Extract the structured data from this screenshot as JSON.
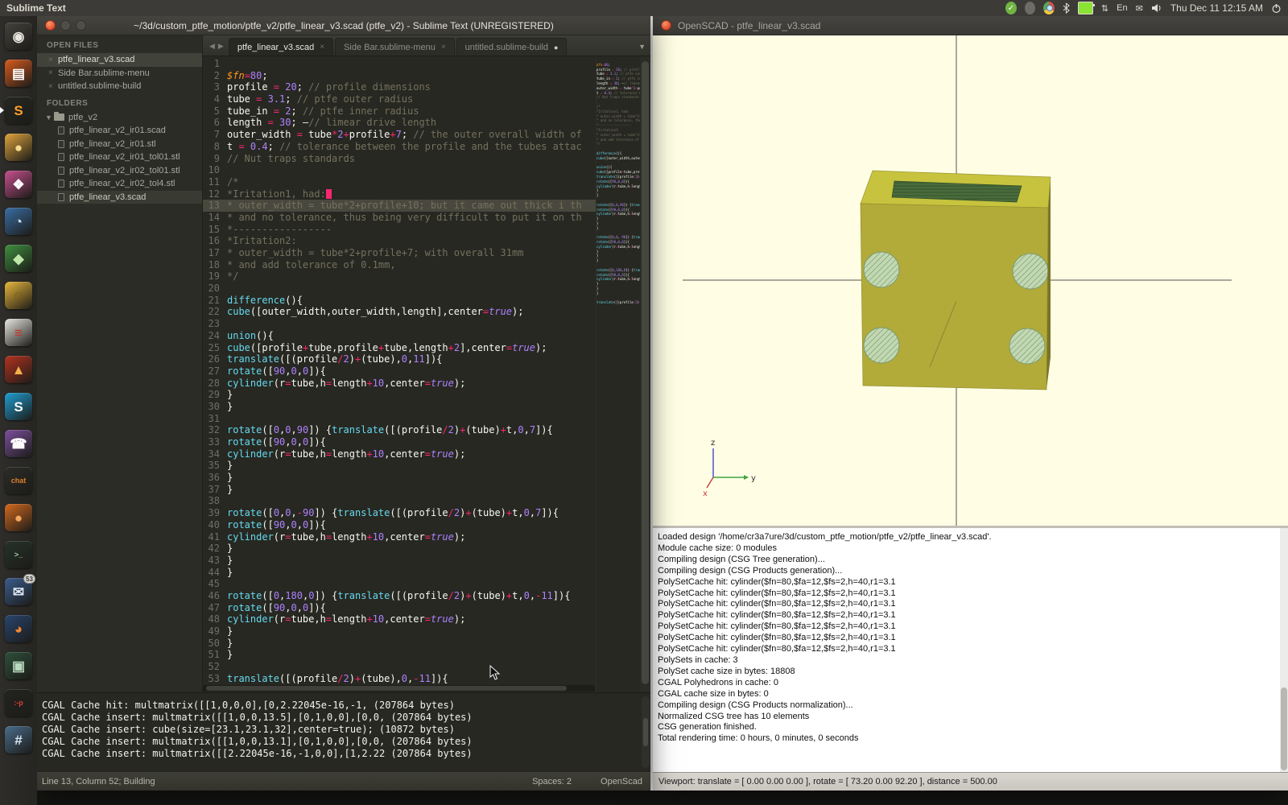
{
  "topbar": {
    "app_label": "Sublime Text",
    "keyboard_layout": "En",
    "clock": "Thu Dec 11 12:15 AM",
    "tray_icon_names": [
      "update-ok-icon",
      "indicator-icon",
      "chromium-tray-icon",
      "bluetooth-icon",
      "battery-icon",
      "network-arrows-icon",
      "keyboard-layout-indicator",
      "mail-indicator-icon",
      "volume-icon",
      "clock",
      "power-menu-icon"
    ]
  },
  "launcher": {
    "icons": [
      {
        "name": "dash-home",
        "glyph": "◉",
        "bg": "#45423c",
        "fg": "#e8e4de"
      },
      {
        "name": "files",
        "glyph": "▤",
        "bg": "#d95b1e",
        "fg": "#ffffff"
      },
      {
        "name": "sublime-text",
        "glyph": "S",
        "bg": "#262622",
        "fg": "#ff9d2e",
        "running": true
      },
      {
        "name": "blender-ball",
        "glyph": "●",
        "bg": "#e0a43c",
        "fg": "#f6d98a"
      },
      {
        "name": "photos",
        "glyph": "❖",
        "bg": "#c84f8e",
        "fg": "#ffffff"
      },
      {
        "name": "chromium-browser",
        "glyph": "◔",
        "bg": "#3a6ea5",
        "fg": "#cfe2f3"
      },
      {
        "name": "leaf-app",
        "glyph": "◆",
        "bg": "#3f8f3f",
        "fg": "#bfe6a8"
      },
      {
        "name": "cheese",
        "glyph": "☺",
        "bg": "#e8b63a",
        "fg": "#7a5a12"
      },
      {
        "name": "text-editor",
        "glyph": "≡",
        "bg": "#e9e6e0",
        "fg": "#c0392b"
      },
      {
        "name": "flame-app",
        "glyph": "▲",
        "bg": "#b5321e",
        "fg": "#f5b04a"
      },
      {
        "name": "skype",
        "glyph": "S",
        "bg": "#1e9fd4",
        "fg": "#ffffff"
      },
      {
        "name": "viber",
        "glyph": "☎",
        "bg": "#7d4f9e",
        "fg": "#ffffff"
      },
      {
        "name": "xchat",
        "glyph": "chat",
        "bg": "#2b2b28",
        "fg": "#e07f28",
        "small": true
      },
      {
        "name": "orange-ball-app",
        "glyph": "●",
        "bg": "#d4691e",
        "fg": "#f2a65e"
      },
      {
        "name": "terminal",
        "glyph": ">_",
        "bg": "#26322a",
        "fg": "#9fd49f",
        "small": true
      },
      {
        "name": "mail-client",
        "glyph": "✉",
        "bg": "#3b5d8f",
        "fg": "#dfe8f4",
        "badge": "53"
      },
      {
        "name": "firefox",
        "glyph": "◕",
        "bg": "#28456e",
        "fg": "#ef8533"
      },
      {
        "name": "camera-app",
        "glyph": "▣",
        "bg": "#2e4f3a",
        "fg": "#b9d9bf"
      },
      {
        "name": "tongue-app",
        "glyph": ":-p",
        "bg": "#232320",
        "fg": "#d8432f",
        "small": true
      },
      {
        "name": "keyboard-app",
        "glyph": "#",
        "bg": "#4a6d8c",
        "fg": "#dce8f2"
      }
    ]
  },
  "sublime": {
    "title": "~/3d/custom_ptfe_motion/ptfe_v2/ptfe_linear_v3.scad (ptfe_v2) - Sublime Text (UNREGISTERED)",
    "sidebar": {
      "open_files_header": "OPEN FILES",
      "open_files": [
        "ptfe_linear_v3.scad",
        "Side Bar.sublime-menu",
        "untitled.sublime-build"
      ],
      "open_files_selected": 0,
      "folders_header": "FOLDERS",
      "folder_name": "ptfe_v2",
      "folder_files": [
        "ptfe_linear_v2_ir01.scad",
        "ptfe_linear_v2_ir01.stl",
        "ptfe_linear_v2_ir01_tol01.stl",
        "ptfe_linear_v2_ir02_tol01.stl",
        "ptfe_linear_v2_ir02_tol4.stl",
        "ptfe_linear_v3.scad"
      ],
      "folder_files_selected": 5
    },
    "tabs": [
      {
        "label": "ptfe_linear_v3.scad",
        "state": "close",
        "active": true
      },
      {
        "label": "Side Bar.sublime-menu",
        "state": "close",
        "active": false
      },
      {
        "label": "untitled.sublime-build",
        "state": "dirty",
        "active": false
      }
    ],
    "editor": {
      "active_line": 13,
      "cursor_line": 12
    },
    "code_lines": [
      "",
      "$fn=80;",
      "profile = 20; // profile dimensions",
      "tube = 3.1; // ptfe outer radius",
      "tube_in = 2; // ptfe inner radius",
      "length = 30; —// limear drive length",
      "outer_width = tube*2+profile+7; // the outer overall width of",
      "t = 0.4; // tolerance between the profile and the tubes attac",
      "// Nut traps standards",
      "",
      "/*",
      "*Iritation1, had:",
      "* outer_width = tube*2+profile+10; but it came out thick i th",
      "* and no tolerance, thus being very difficult to put it on th",
      "*-----------------",
      "*Iritation2:",
      "* outer_width = tube*2+profile+7; with overall 31mm",
      "* and add tolerance of 0.1mm,",
      "*/",
      "",
      "difference(){",
      "cube([outer_width,outer_width,length],center=true);",
      "",
      "union(){",
      "cube([profile+tube,profile+tube,length+2],center=true);",
      "translate([(profile/2)+(tube),0,11]){",
      "rotate([90,0,0]){",
      "cylinder(r=tube,h=length+10,center=true);",
      "}",
      "}",
      "",
      "rotate([0,0,90]) {translate([(profile/2)+(tube)+t,0,7]){",
      "rotate([90,0,0]){",
      "cylinder(r=tube,h=length+10,center=true);",
      "}",
      "}",
      "}",
      "",
      "rotate([0,0,-90]) {translate([(profile/2)+(tube)+t,0,7]){",
      "rotate([90,0,0]){",
      "cylinder(r=tube,h=length+10,center=true);",
      "}",
      "}",
      "}",
      "",
      "rotate([0,180,0]) {translate([(profile/2)+(tube)+t,0,-11]){",
      "rotate([90,0,0]){",
      "cylinder(r=tube,h=length+10,center=true);",
      "}",
      "}",
      "}",
      "",
      "translate([(profile/2)+(tube),0,-11]){"
    ],
    "build_output": [
      "CGAL Cache hit: multmatrix([[1,0,0,0],[0,2.22045e-16,-1, (207864 bytes)",
      "CGAL Cache insert: multmatrix([[1,0,0,13.5],[0,1,0,0],[0,0, (207864 bytes)",
      "CGAL Cache insert: cube(size=[23.1,23.1,32],center=true); (10872 bytes)",
      "CGAL Cache insert: multmatrix([[1,0,0,13.1],[0,1,0,0],[0,0, (207864 bytes)",
      "CGAL Cache insert: multmatrix([[2.22045e-16,-1,0,0],[1,2.22 (207864 bytes)"
    ],
    "status": {
      "left": "Line 13, Column 52; Building",
      "spaces": "Spaces: 2",
      "syntax": "OpenScad"
    }
  },
  "openscad": {
    "title": "OpenSCAD - ptfe_linear_v3.scad",
    "axis": {
      "x": "x",
      "y": "y",
      "z": "z"
    },
    "console_lines": [
      "Loaded design '/home/cr3a7ure/3d/custom_ptfe_motion/ptfe_v2/ptfe_linear_v3.scad'.",
      "Module cache size: 0 modules",
      "Compiling design (CSG Tree generation)...",
      "Compiling design (CSG Products generation)...",
      "PolySetCache hit: cylinder($fn=80,$fa=12,$fs=2,h=40,r1=3.1",
      "PolySetCache hit: cylinder($fn=80,$fa=12,$fs=2,h=40,r1=3.1",
      "PolySetCache hit: cylinder($fn=80,$fa=12,$fs=2,h=40,r1=3.1",
      "PolySetCache hit: cylinder($fn=80,$fa=12,$fs=2,h=40,r1=3.1",
      "PolySetCache hit: cylinder($fn=80,$fa=12,$fs=2,h=40,r1=3.1",
      "PolySetCache hit: cylinder($fn=80,$fa=12,$fs=2,h=40,r1=3.1",
      "PolySetCache hit: cylinder($fn=80,$fa=12,$fs=2,h=40,r1=3.1",
      "PolySets in cache: 3",
      "PolySet cache size in bytes: 18808",
      "CGAL Polyhedrons in cache: 0",
      "CGAL cache size in bytes: 0",
      "Compiling design (CSG Products normalization)...",
      "Normalized CSG tree has 10 elements",
      "CSG generation finished.",
      "Total rendering time: 0 hours, 0 minutes, 0 seconds"
    ],
    "statusbar": "Viewport: translate = [ 0.00 0.00 0.00 ], rotate = [ 73.20 0.00 92.20 ], distance = 500.00",
    "colors": {
      "viewport_bg": "#fffee5",
      "object_front": "#b2ab3a",
      "object_top": "#c8c33e",
      "object_side": "#7a7428",
      "hole_fill": "#c2d8b2",
      "hole_hatch": "#74946a",
      "inset_fill": "#3f6034",
      "inset_hatch": "#5b8049"
    }
  }
}
